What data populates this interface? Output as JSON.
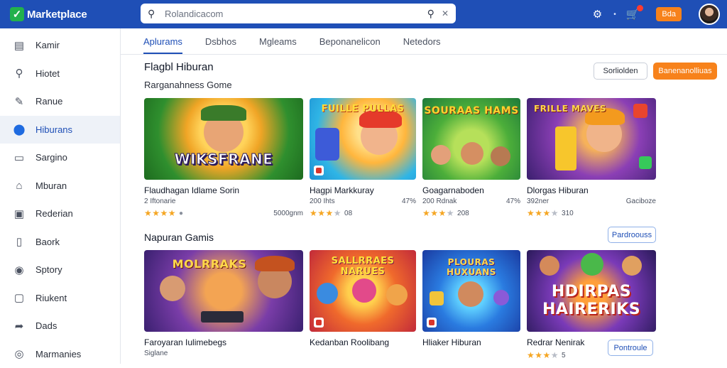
{
  "colors": {
    "brand": "#1f4fb6",
    "accent": "#f7821b",
    "star": "#f5a623"
  },
  "header": {
    "app_name": "Marketplace",
    "search_value": "Rolandicacom",
    "action_button": "Bda",
    "icons": [
      "checkmark-icon",
      "search-icon",
      "clear-icon",
      "settings-icon",
      "notification-icon",
      "avatar"
    ]
  },
  "sidebar": {
    "items": [
      {
        "label": "Kamir",
        "icon": "dashboard-icon"
      },
      {
        "label": "Hiotet",
        "icon": "search-icon"
      },
      {
        "label": "Ranue",
        "icon": "edit-icon"
      },
      {
        "label": "Hiburans",
        "icon": "compass-icon",
        "active": true
      },
      {
        "label": "Sargino",
        "icon": "window-icon"
      },
      {
        "label": "Mburan",
        "icon": "home-icon"
      },
      {
        "label": "Rederian",
        "icon": "monitor-icon"
      },
      {
        "label": "Baork",
        "icon": "book-icon"
      },
      {
        "label": "Sptory",
        "icon": "user-circle-icon"
      },
      {
        "label": "Riukent",
        "icon": "tablet-icon"
      },
      {
        "label": "Dads",
        "icon": "share-icon"
      },
      {
        "label": "Marmanies",
        "icon": "clock-icon"
      }
    ]
  },
  "tabs": [
    {
      "label": "Aplurams",
      "active": true
    },
    {
      "label": "Dsbhos"
    },
    {
      "label": "Mgleams"
    },
    {
      "label": "Beponanelicon"
    },
    {
      "label": "Netedors"
    }
  ],
  "section1": {
    "title": "Flagbl Hiburan",
    "subtitle": "Rarganahness Gome",
    "sort_button": "Sorliolden",
    "action_button": "Banenanolliuas",
    "cards": [
      {
        "art_text": "WIKSFRANE",
        "title": "Flaudhagan Idlame Sorin",
        "meta": "2 Iftonarie",
        "rating": 4,
        "rating_text": "",
        "right": "5000gnm"
      },
      {
        "art_text": "FUILLE PULLAS",
        "title": "Hagpi Markkuray",
        "meta": "200 Ihts",
        "rating": 3,
        "rating_text": "08",
        "right": "47%"
      },
      {
        "art_text": "SOURAAS HAMS",
        "title": "Goagarnaboden",
        "meta": "200 Rdnak",
        "rating": 3,
        "rating_text": "208",
        "right": "47%"
      },
      {
        "art_text": "FRILLE MAVES",
        "title": "Dlorgas Hiburan",
        "meta": "392ner",
        "rating": 3,
        "rating_text": "310",
        "right": "Gaciboze"
      }
    ]
  },
  "section2": {
    "title": "Napuran Gamis",
    "top_button": "Pardroouss",
    "bottom_button": "Pontroule",
    "cards": [
      {
        "art_text": "MOLRRAKS",
        "title": "Faroyaran Iulimebegs",
        "meta": "Siglane"
      },
      {
        "art_text": "SALLRRAES NARUES",
        "title": "Kedanban Roolibang",
        "meta": ""
      },
      {
        "art_text": "PLOURAS HUXUANS",
        "title": "Hliaker Hiburan",
        "meta": ""
      },
      {
        "art_text": "HDIRPAS HAIRERIKS",
        "title": "Redrar Nenirak",
        "meta": "",
        "rating": 3,
        "rating_text": "5"
      }
    ]
  }
}
